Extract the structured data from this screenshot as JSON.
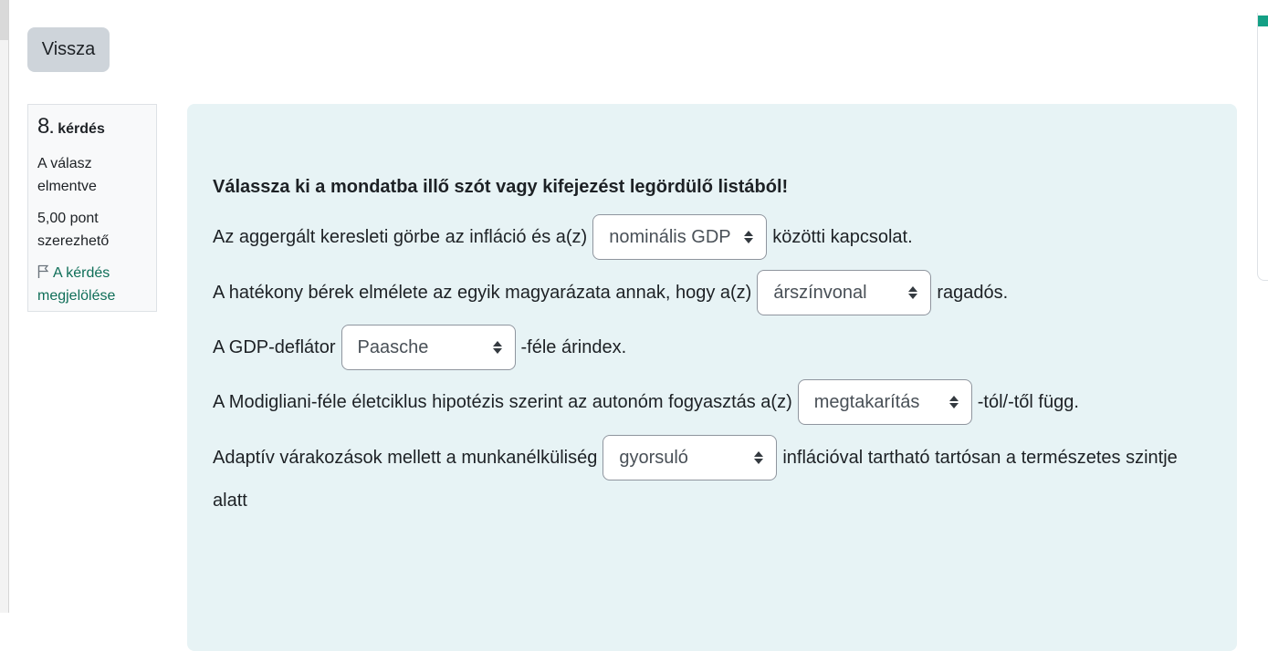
{
  "back_button": {
    "label": "Vissza"
  },
  "info": {
    "question_number": "8",
    "question_word": ". kérdés",
    "status": "A válasz elmentve",
    "points": "5,00 pont szerezhető",
    "flag_label": "A kérdés megjelölése"
  },
  "question": {
    "prompt": "Válassza ki a mondatba illő szót vagy kifejezést legördülő listából!",
    "lines": [
      {
        "before": "Az aggergált keresleti görbe az infláció és a(z)",
        "selected": "nominális GDP",
        "after": "közötti kapcsolat."
      },
      {
        "before": "A hatékony bérek elmélete az egyik magyarázata annak, hogy a(z)",
        "selected": "árszínvonal",
        "after": "ragadós."
      },
      {
        "before": "A GDP-deflátor",
        "selected": "Paasche",
        "after": "-féle árindex."
      },
      {
        "before": "A Modigliani-féle életciklus hipotézis szerint az autonóm fogyasztás a(z)",
        "selected": "megtakarítás",
        "after": "-tól/-től függ."
      },
      {
        "before": "Adaptív várakozások mellett a munkanélküliség",
        "selected": "gyorsuló",
        "after": "inflációval tartható tartósan a természetes szintje",
        "continuation": "alatt"
      }
    ]
  },
  "colors": {
    "panel_bg": "#e7f3f5",
    "link": "#0f6e58",
    "button_bg": "#ced4da",
    "nav_accent": "#14a085"
  },
  "icons": {
    "flag": "flag-icon",
    "select_caret": "sort-caret-icon"
  }
}
